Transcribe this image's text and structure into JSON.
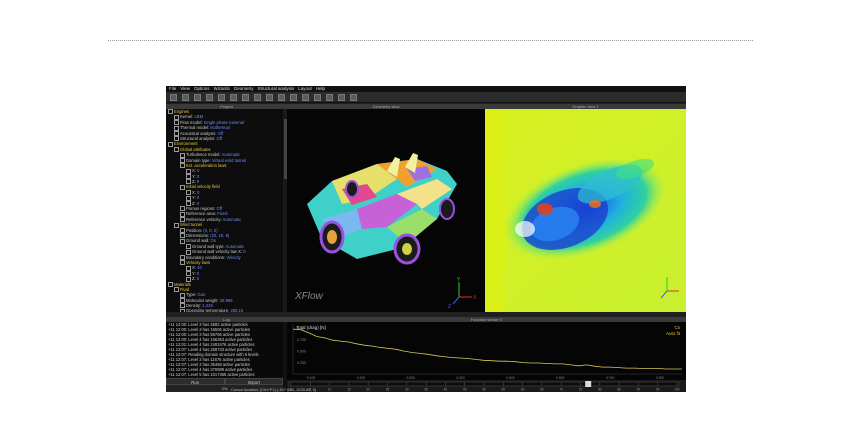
{
  "menu": [
    "File",
    "View",
    "Options",
    "Wizards",
    "Geometry",
    "Structural analysis",
    "Layout",
    "Help"
  ],
  "panels": {
    "tree_title": "Project",
    "view1_title": "Geometry view",
    "view2_title": "Graphic view 1",
    "log_title": "Log",
    "plot_title": "Function viewer 0"
  },
  "tree": [
    {
      "indent": 0,
      "label": "Engines",
      "value": "",
      "color": "y"
    },
    {
      "indent": 1,
      "label": "Kernel:",
      "value": "LBM",
      "color": "v"
    },
    {
      "indent": 1,
      "label": "Flow model:",
      "value": "Single phase external",
      "color": "v"
    },
    {
      "indent": 1,
      "label": "Thermal model:",
      "value": "Isothermal",
      "color": "v"
    },
    {
      "indent": 1,
      "label": "Acoustical analysis:",
      "value": "Off",
      "color": "v"
    },
    {
      "indent": 1,
      "label": "Structural analysis:",
      "value": "Off",
      "color": "v"
    },
    {
      "indent": 0,
      "label": "Environment",
      "value": "",
      "color": "y"
    },
    {
      "indent": 1,
      "label": "Global attributes",
      "value": "",
      "color": "y"
    },
    {
      "indent": 2,
      "label": "Turbulence model:",
      "value": "Automatic",
      "color": "v"
    },
    {
      "indent": 2,
      "label": "Domain type:",
      "value": "Virtual wind tunnel",
      "color": "v"
    },
    {
      "indent": 2,
      "label": "Ext. acceleration laws",
      "value": "",
      "color": "y"
    },
    {
      "indent": 3,
      "label": "X:",
      "value": "0",
      "color": "v"
    },
    {
      "indent": 3,
      "label": "Y:",
      "value": "0",
      "color": "v"
    },
    {
      "indent": 3,
      "label": "Z:",
      "value": "0",
      "color": "v"
    },
    {
      "indent": 2,
      "label": "Initial velocity field",
      "value": "",
      "color": "y"
    },
    {
      "indent": 3,
      "label": "X:",
      "value": "0",
      "color": "v"
    },
    {
      "indent": 3,
      "label": "Y:",
      "value": "0",
      "color": "v"
    },
    {
      "indent": 3,
      "label": "Z:",
      "value": "0",
      "color": "v"
    },
    {
      "indent": 2,
      "label": "Porous regions:",
      "value": "Off",
      "color": "v"
    },
    {
      "indent": 2,
      "label": "Reference area:",
      "value": "Fixed",
      "color": "v"
    },
    {
      "indent": 2,
      "label": "Reference velocity:",
      "value": "Automatic",
      "color": "v"
    },
    {
      "indent": 1,
      "label": "Wind tunnel",
      "value": "",
      "color": "y"
    },
    {
      "indent": 2,
      "label": "Position:",
      "value": "(0, 0, 0)",
      "color": "v"
    },
    {
      "indent": 2,
      "label": "Dimensions:",
      "value": "(20, 10, 8)",
      "color": "v"
    },
    {
      "indent": 2,
      "label": "Ground wall:",
      "value": "On",
      "color": "v"
    },
    {
      "indent": 3,
      "label": "Ground wall type:",
      "value": "Automatic",
      "color": "v"
    },
    {
      "indent": 3,
      "label": "Ground wall velocity law X:",
      "value": "0",
      "color": "v"
    },
    {
      "indent": 2,
      "label": "Boundary conditions:",
      "value": "Velocity",
      "color": "v"
    },
    {
      "indent": 2,
      "label": "Velocity laws",
      "value": "",
      "color": "y"
    },
    {
      "indent": 3,
      "label": "X:",
      "value": "40",
      "color": "v"
    },
    {
      "indent": 3,
      "label": "Y:",
      "value": "0",
      "color": "v"
    },
    {
      "indent": 3,
      "label": "Z:",
      "value": "0",
      "color": "v"
    },
    {
      "indent": 0,
      "label": "",
      "value": "",
      "color": "v"
    },
    {
      "indent": 0,
      "label": "Materials",
      "value": "",
      "color": "y"
    },
    {
      "indent": 1,
      "label": "Fluid",
      "value": "",
      "color": "y"
    },
    {
      "indent": 2,
      "label": "Type:",
      "value": "Gas",
      "color": "v"
    },
    {
      "indent": 2,
      "label": "Molecular weight:",
      "value": "28.966",
      "color": "v"
    },
    {
      "indent": 2,
      "label": "Density:",
      "value": "1.225",
      "color": "v"
    },
    {
      "indent": 2,
      "label": "Operating temperature:",
      "value": "288.15",
      "color": "v"
    }
  ],
  "log": [
    "+11 12:00:  Level 3 has 4592 active particles",
    "+11 12:00:  Level 3 has 15506 active particles",
    "+11 12:00:  Level 3 has 55755 active particles",
    "+11 12:00:  Level 4 has 156363 active particles",
    "+11 12:01:  Level 4 has 2402476 active particles",
    "+11 12:07:  Level 4 has 258733 active particles",
    "+11 12:07:  Reading domain structure with 6 levels",
    "+11 12:07:  Level 2 has 11676 active particles",
    "+11 12:07:  Level 3 has 36468 active particles",
    "+11 12:07:  Level 4 has 370989 active particles",
    "+11 12:07:  Level 5 has 1017368 active particles",
    "+11 12:07:  Level 6 has 3008213 active particles"
  ],
  "log_buttons": [
    "Run",
    "Import"
  ],
  "progress": {
    "label": "0%",
    "fraction": 0.0
  },
  "status": "Cursor location: [Ctrl+F1] (-407.684, 1930.65, 0)",
  "brand": "XFlow",
  "axis_labels": {
    "x": "X",
    "y": "Y",
    "z": "Z"
  },
  "plot": {
    "series_label": "Total (drag) [N]",
    "legend_top": "Cx",
    "legend_bottom": "Auto fit",
    "y_ticks": [
      "1.00",
      "0.750",
      "0.500",
      "0.250"
    ],
    "x_ticks": [
      "0.100",
      "0.100",
      "0.200",
      "0.400",
      "0.600",
      "0.800",
      "0.750",
      "0.900"
    ],
    "values": [
      0.98,
      0.97,
      0.9,
      0.82,
      0.79,
      0.74,
      0.72,
      0.7,
      0.66,
      0.63,
      0.61,
      0.58,
      0.56,
      0.54,
      0.5,
      0.47,
      0.45,
      0.43,
      0.4,
      0.38,
      0.36,
      0.35,
      0.34,
      0.32,
      0.3,
      0.29,
      0.28,
      0.28,
      0.27,
      0.25,
      0.24,
      0.24,
      0.23,
      0.22,
      0.22,
      0.2,
      0.18,
      0.2,
      0.17,
      0.15,
      0.15,
      0.14,
      0.13,
      0.13,
      0.12,
      0.12,
      0.12,
      0.11,
      0.11,
      0.11
    ],
    "ylim": [
      0,
      1.05
    ]
  },
  "timeline": {
    "ticks": [
      "0",
      "5",
      "10",
      "15",
      "20",
      "25",
      "30",
      "35",
      "40",
      "45",
      "50",
      "55",
      "60",
      "65",
      "70",
      "75",
      "80",
      "85",
      "90",
      "95",
      "100"
    ],
    "position": 0.77
  },
  "colors": {
    "accent_yellow": "#e9c63a",
    "link_blue": "#6d8cff",
    "plot_line": "#d9c95a"
  },
  "icons": [
    "new-icon",
    "open-icon",
    "save-icon",
    "print-icon",
    "wand-icon",
    "move-icon",
    "rotate-icon",
    "scale-icon",
    "grid-icon",
    "mesh-icon",
    "cut-icon",
    "probe-icon",
    "play-icon",
    "stop-icon",
    "pause-icon",
    "settings-icon"
  ]
}
